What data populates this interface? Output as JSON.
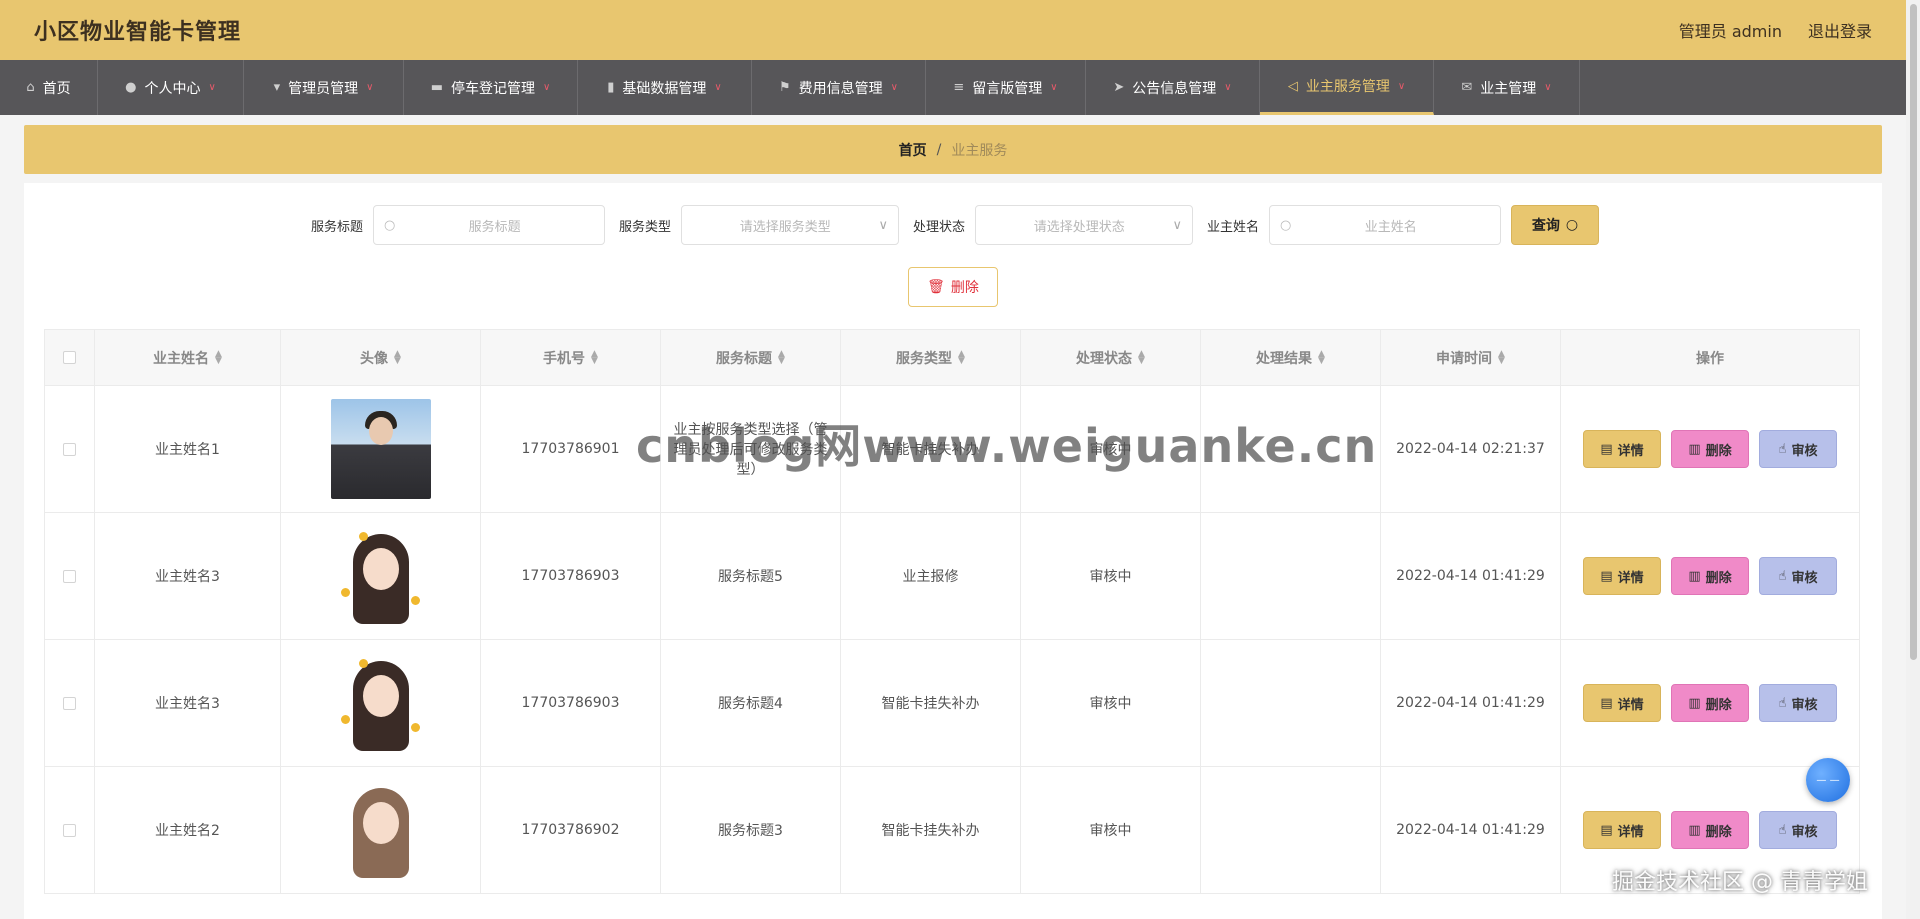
{
  "header": {
    "title": "小区物业智能卡管理",
    "admin_label": "管理员 admin",
    "logout_label": "退出登录"
  },
  "nav": {
    "items": [
      {
        "label": "首页",
        "icon": "home-icon"
      },
      {
        "label": "个人中心",
        "icon": "user-icon"
      },
      {
        "label": "管理员管理",
        "icon": "pin-icon"
      },
      {
        "label": "停车登记管理",
        "icon": "chat-icon"
      },
      {
        "label": "基础数据管理",
        "icon": "chart-icon"
      },
      {
        "label": "费用信息管理",
        "icon": "flag-icon"
      },
      {
        "label": "留言版管理",
        "icon": "menu-icon"
      },
      {
        "label": "公告信息管理",
        "icon": "send-icon"
      },
      {
        "label": "业主服务管理",
        "icon": "navigate-icon"
      },
      {
        "label": "业主管理",
        "icon": "mail-icon"
      }
    ]
  },
  "breadcrumb": {
    "home": "首页",
    "separator": "/",
    "current": "业主服务"
  },
  "search": {
    "title_label": "服务标题",
    "title_placeholder": "服务标题",
    "type_label": "服务类型",
    "type_placeholder": "请选择服务类型",
    "status_label": "处理状态",
    "status_placeholder": "请选择处理状态",
    "name_label": "业主姓名",
    "name_placeholder": "业主姓名",
    "query_label": "查询"
  },
  "actions": {
    "delete_label": "删除"
  },
  "table": {
    "headers": {
      "name": "业主姓名",
      "avatar": "头像",
      "phone": "手机号",
      "title": "服务标题",
      "type": "服务类型",
      "status": "处理状态",
      "result": "处理结果",
      "time": "申请时间",
      "ops": "操作"
    },
    "buttons": {
      "detail": "详情",
      "delete": "删除",
      "audit": "审核"
    },
    "rows": [
      {
        "name": "业主姓名1",
        "phone": "17703786901",
        "title": "业主按服务类型选择（管理员处理后可修改服务类型）",
        "type": "智能卡挂失补办",
        "status": "审核中",
        "result": "",
        "time": "2022-04-14 02:21:37"
      },
      {
        "name": "业主姓名3",
        "phone": "17703786903",
        "title": "服务标题5",
        "type": "业主报修",
        "status": "审核中",
        "result": "",
        "time": "2022-04-14 01:41:29"
      },
      {
        "name": "业主姓名3",
        "phone": "17703786903",
        "title": "服务标题4",
        "type": "智能卡挂失补办",
        "status": "审核中",
        "result": "",
        "time": "2022-04-14 01:41:29"
      },
      {
        "name": "业主姓名2",
        "phone": "17703786902",
        "title": "服务标题3",
        "type": "智能卡挂失补办",
        "status": "审核中",
        "result": "",
        "time": "2022-04-14 01:41:29"
      }
    ]
  },
  "watermark": "cnblog网www.weiguanke.cn",
  "footer_mark": "掘金技术社区 @ 青青学姐",
  "colors": {
    "accent": "#e8c66f",
    "nav_bg": "#575659",
    "delete_pink": "#f08ac8",
    "audit_blue": "#b7c0ea",
    "danger_red": "#e0303a"
  }
}
